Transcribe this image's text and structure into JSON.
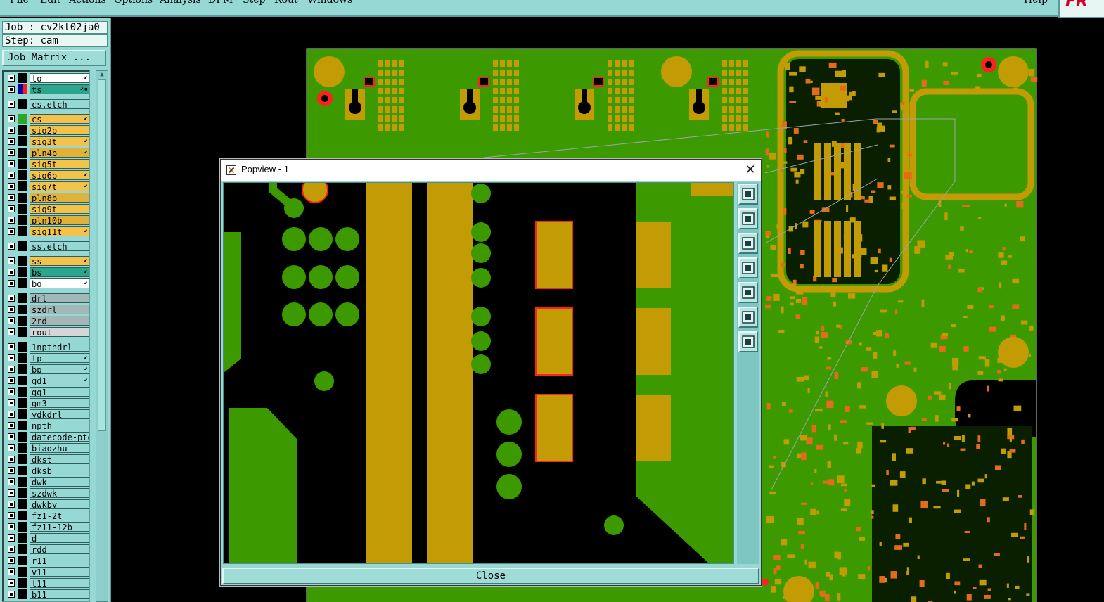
{
  "menu": [
    {
      "label": "File"
    },
    {
      "label": "Edit"
    },
    {
      "label": "Actions"
    },
    {
      "label": "Options"
    },
    {
      "label": "Analysis"
    },
    {
      "label": "DFM"
    },
    {
      "label": "Step"
    },
    {
      "label": "Rout"
    },
    {
      "label": "Windows"
    },
    {
      "label": "Help"
    }
  ],
  "logo": "FR",
  "job": {
    "job_label": "Job : cv2kt02ja0",
    "step_label": "Step: cam",
    "matrix_button": "Job Matrix ..."
  },
  "layers": [
    {
      "name": "to",
      "color": "#ffffff",
      "swatch": "#000000",
      "mark": "⬋"
    },
    {
      "name": "ts",
      "color": "#2ba58b",
      "swatch": "#ff1a1a",
      "mark": "⬋▪",
      "swatch2": "#0000aa"
    },
    {
      "name": "cs.etch",
      "color": "#96d8d4",
      "swatch": "#000000",
      "mark": ""
    },
    {
      "name": "cs",
      "color": "#f3c24a",
      "swatch": "#2ea52b",
      "mark": "⬋"
    },
    {
      "name": "sig2b",
      "color": "#f3c24a",
      "swatch": "#000000",
      "mark": ""
    },
    {
      "name": "sig3t",
      "color": "#f3c24a",
      "swatch": "#000000",
      "mark": "⬋"
    },
    {
      "name": "pln4b",
      "color": "#e0b23a",
      "swatch": "#000000",
      "mark": "⬋"
    },
    {
      "name": "sig5t",
      "color": "#f3c24a",
      "swatch": "#000000",
      "mark": ""
    },
    {
      "name": "sig6b",
      "color": "#f3c24a",
      "swatch": "#000000",
      "mark": "⬋"
    },
    {
      "name": "sig7t",
      "color": "#f3c24a",
      "swatch": "#000000",
      "mark": "⬋"
    },
    {
      "name": "pln8b",
      "color": "#e0b23a",
      "swatch": "#000000",
      "mark": ""
    },
    {
      "name": "sig9t",
      "color": "#f3c24a",
      "swatch": "#000000",
      "mark": ""
    },
    {
      "name": "pln10b",
      "color": "#e0b23a",
      "swatch": "#000000",
      "mark": ""
    },
    {
      "name": "sig11t",
      "color": "#f3c24a",
      "swatch": "#000000",
      "mark": "⬋"
    },
    {
      "name": "ss.etch",
      "color": "#96d8d4",
      "swatch": "#000000",
      "mark": ""
    },
    {
      "name": "ss",
      "color": "#f3c24a",
      "swatch": "#000000",
      "mark": "⬋"
    },
    {
      "name": "bs",
      "color": "#2ba58b",
      "swatch": "#000000",
      "mark": "⬋"
    },
    {
      "name": "bo",
      "color": "#ffffff",
      "swatch": "#000000",
      "mark": "⬋"
    },
    {
      "name": "drl",
      "color": "#a3b6b8",
      "swatch": "#000000",
      "mark": ""
    },
    {
      "name": "szdrl",
      "color": "#a3b6b8",
      "swatch": "#000000",
      "mark": ""
    },
    {
      "name": "2rd",
      "color": "#a3b6b8",
      "swatch": "#000000",
      "mark": ""
    },
    {
      "name": "rout",
      "color": "#d6d6d6",
      "swatch": "#000000",
      "mark": ""
    },
    {
      "name": "1npthdrl",
      "color": "#96d8d4",
      "swatch": "#000000",
      "mark": ""
    },
    {
      "name": "tp",
      "color": "#96d8d4",
      "swatch": "#000000",
      "mark": "⬋"
    },
    {
      "name": "bp",
      "color": "#96d8d4",
      "swatch": "#000000",
      "mark": "⬋"
    },
    {
      "name": "gd1",
      "color": "#96d8d4",
      "swatch": "#000000",
      "mark": "⬋"
    },
    {
      "name": "gg1",
      "color": "#96d8d4",
      "swatch": "#000000",
      "mark": ""
    },
    {
      "name": "gm3",
      "color": "#96d8d4",
      "swatch": "#000000",
      "mark": ""
    },
    {
      "name": "ydkdrl",
      "color": "#96d8d4",
      "swatch": "#000000",
      "mark": ""
    },
    {
      "name": "npth",
      "color": "#96d8d4",
      "swatch": "#000000",
      "mark": ""
    },
    {
      "name": "datecode-pto",
      "color": "#96d8d4",
      "swatch": "#000000",
      "mark": ""
    },
    {
      "name": "biaozhu",
      "color": "#96d8d4",
      "swatch": "#000000",
      "mark": ""
    },
    {
      "name": "dkst",
      "color": "#96d8d4",
      "swatch": "#000000",
      "mark": ""
    },
    {
      "name": "dksb",
      "color": "#96d8d4",
      "swatch": "#000000",
      "mark": ""
    },
    {
      "name": "dwk",
      "color": "#96d8d4",
      "swatch": "#000000",
      "mark": ""
    },
    {
      "name": "szdwk",
      "color": "#96d8d4",
      "swatch": "#000000",
      "mark": ""
    },
    {
      "name": "dwkby",
      "color": "#96d8d4",
      "swatch": "#000000",
      "mark": ""
    },
    {
      "name": "fz1-2t",
      "color": "#96d8d4",
      "swatch": "#000000",
      "mark": ""
    },
    {
      "name": "fz11-12b",
      "color": "#96d8d4",
      "swatch": "#000000",
      "mark": ""
    },
    {
      "name": "d",
      "color": "#96d8d4",
      "swatch": "#000000",
      "mark": ""
    },
    {
      "name": "rdd",
      "color": "#96d8d4",
      "swatch": "#000000",
      "mark": ""
    },
    {
      "name": "r11",
      "color": "#96d8d4",
      "swatch": "#000000",
      "mark": ""
    },
    {
      "name": "v11",
      "color": "#96d8d4",
      "swatch": "#000000",
      "mark": ""
    },
    {
      "name": "t11",
      "color": "#96d8d4",
      "swatch": "#000000",
      "mark": ""
    },
    {
      "name": "b11",
      "color": "#96d8d4",
      "swatch": "#000000",
      "mark": ""
    }
  ],
  "popview": {
    "title": "Popview - 1",
    "close_x": "✕",
    "close_button": "Close",
    "tools": [
      "zoom-home-icon",
      "zoom-in-icon",
      "zoom-out-icon",
      "pan-left-icon",
      "pan-right-icon",
      "fit-all-icon",
      "center-icon"
    ]
  },
  "colors": {
    "panel": "#96d8d4",
    "copper": "#c29b05",
    "board": "#3c9a00",
    "highlight": "#ff2020"
  }
}
